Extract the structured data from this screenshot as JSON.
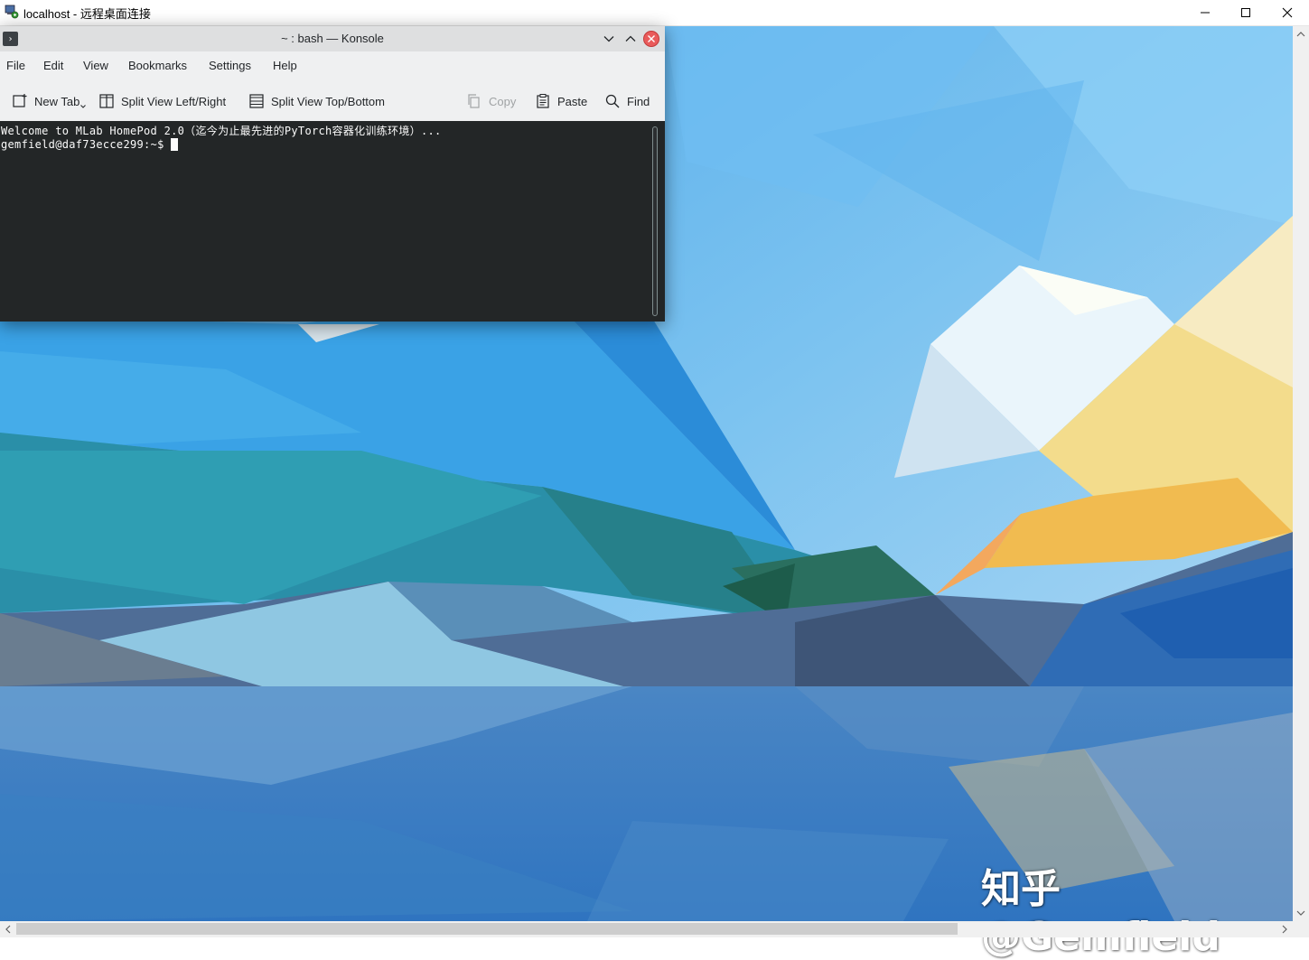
{
  "rdp": {
    "title": "localhost - 远程桌面连接"
  },
  "konsole": {
    "title": "~ : bash — Konsole",
    "menu": [
      "File",
      "Edit",
      "View",
      "Bookmarks",
      "Settings",
      "Help"
    ],
    "toolbar": {
      "new_tab": "New Tab",
      "split_lr": "Split View Left/Right",
      "split_tb": "Split View Top/Bottom",
      "copy": "Copy",
      "paste": "Paste",
      "find": "Find"
    },
    "terminal": {
      "line1": "Welcome to MLab HomePod 2.0（迄今为止最先进的PyTorch容器化训练环境）...",
      "prompt": "gemfield@daf73ecce299:~$ "
    }
  },
  "watermark": "知乎 @Gemfield",
  "colors": {
    "terminal_bg": "#232627",
    "terminal_fg": "#fcfcfc",
    "close_button": "#e95b5b"
  }
}
